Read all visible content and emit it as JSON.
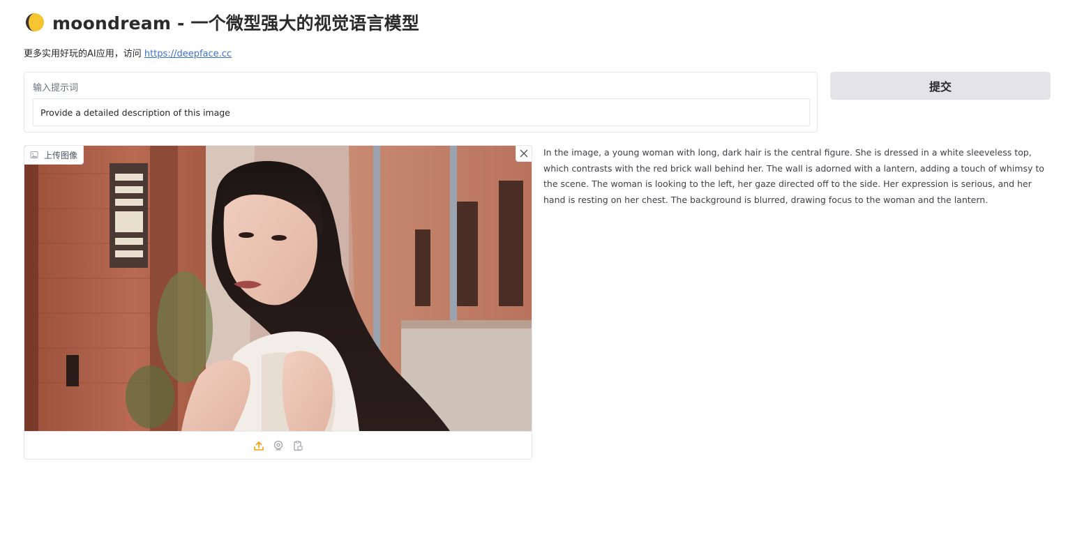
{
  "header": {
    "title": "moondream - 一个微型强大的视觉语言模型",
    "icon": "moon-icon"
  },
  "subline": {
    "text": "更多实用好玩的AI应用，访问",
    "link_text": "https://deepface.cc"
  },
  "prompt": {
    "label": "输入提示词",
    "value": "Provide a detailed description of this image"
  },
  "submit": {
    "label": "提交"
  },
  "image_panel": {
    "label": "上传图像",
    "label_icon": "image-icon",
    "clear_icon": "close-icon",
    "toolbar_icons": [
      "upload-icon",
      "webcam-icon",
      "clipboard-icon"
    ],
    "accent_color": "#f59e0b"
  },
  "output": {
    "text": "In the image, a young woman with long, dark hair is the central figure. She is dressed in a white sleeveless top, which contrasts with the red brick wall behind her. The wall is adorned with a lantern, adding a touch of whimsy to the scene. The woman is looking to the left, her gaze directed off to the side. Her expression is serious, and her hand is resting on her chest. The background is blurred, drawing focus to the woman and the lantern."
  }
}
